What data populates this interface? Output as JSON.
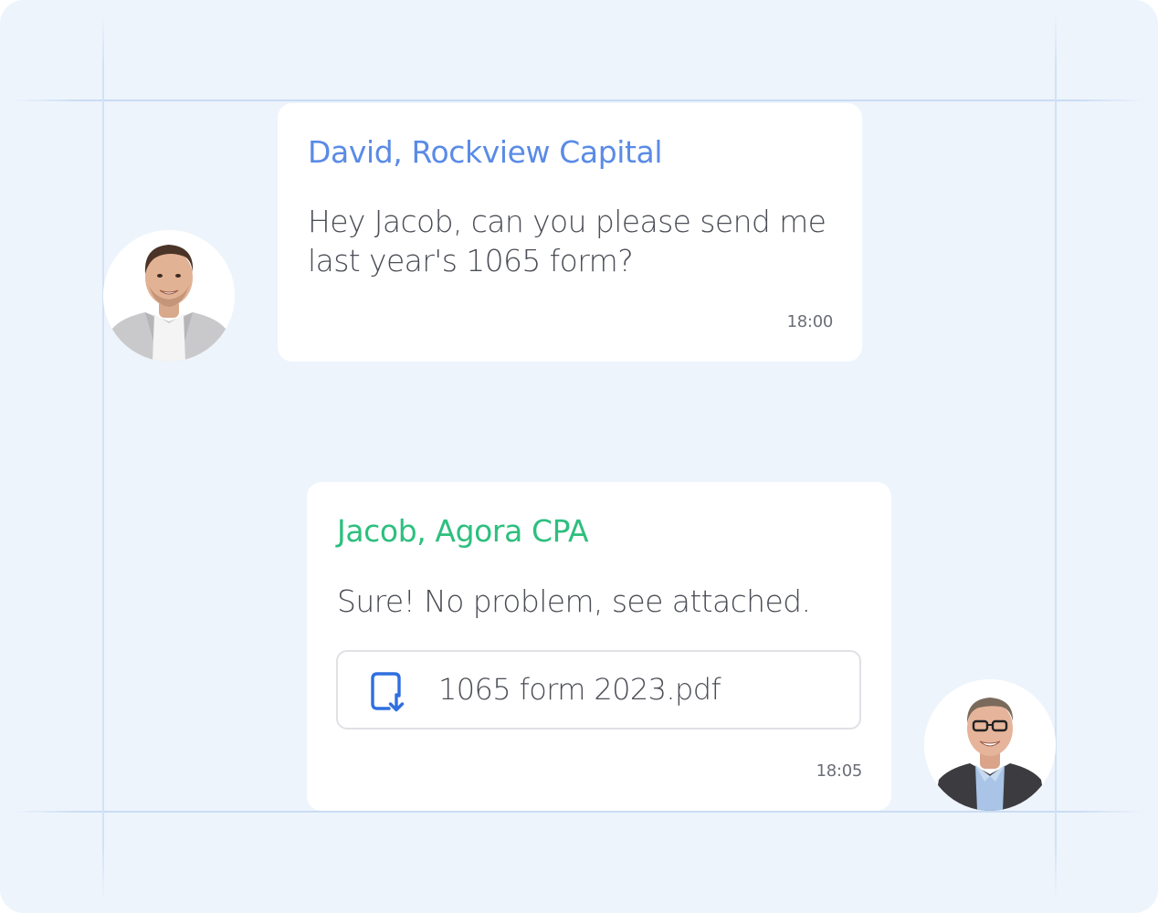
{
  "colors": {
    "background": "#eef4fc",
    "bubble": "#ffffff",
    "david_name": "#5a8be6",
    "jacob_name": "#2dbf7e",
    "message_text": "#4a4d55",
    "file_icon": "#2f6fe0"
  },
  "messages": [
    {
      "sender": "David, Rockview Capital",
      "text": "Hey Jacob, can you please send me last year's 1065 form?",
      "time": "18:00",
      "avatar_icon": "man-portrait-light-blazer"
    },
    {
      "sender": "Jacob, Agora CPA",
      "text": "Sure! No problem, see attached.",
      "attachment": {
        "icon": "file-download-icon",
        "filename": "1065 form 2023.pdf"
      },
      "time": "18:05",
      "avatar_icon": "man-portrait-glasses-dark-suit"
    }
  ]
}
